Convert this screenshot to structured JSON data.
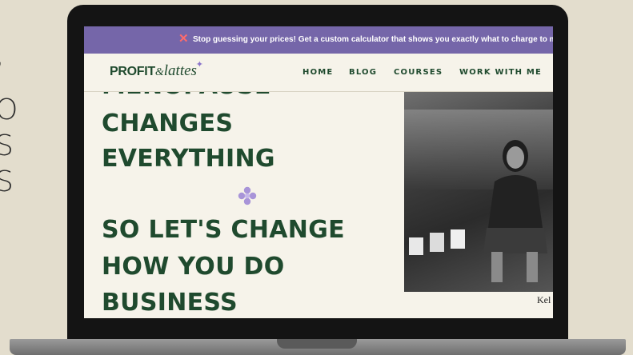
{
  "side_text": [
    "’",
    "O",
    "S",
    "S"
  ],
  "announcement": {
    "icon": "x-icon",
    "text": "Stop guessing your prices! Get a custom calculator that shows you exactly what to charge to m"
  },
  "nav": {
    "logo": {
      "profit": "PROFIT",
      "amp": "&",
      "lattes": "lattes"
    },
    "links": [
      "HOME",
      "BLOG",
      "COURSES",
      "WORK WITH ME"
    ]
  },
  "hero": {
    "cut_line": "MENOPAUSE",
    "line1": "CHANGES",
    "line2": "EVERYTHING",
    "line3": "SO LET'S CHANGE",
    "line4": "HOW YOU DO",
    "line5": "BUSINESS",
    "caption": "Kel"
  },
  "colors": {
    "brand_green": "#1f4a2e",
    "banner_purple": "#7566a9",
    "accent_lilac": "#a894d8",
    "page_bg": "#f6f3ea",
    "outer_bg": "#e3ddcd"
  }
}
